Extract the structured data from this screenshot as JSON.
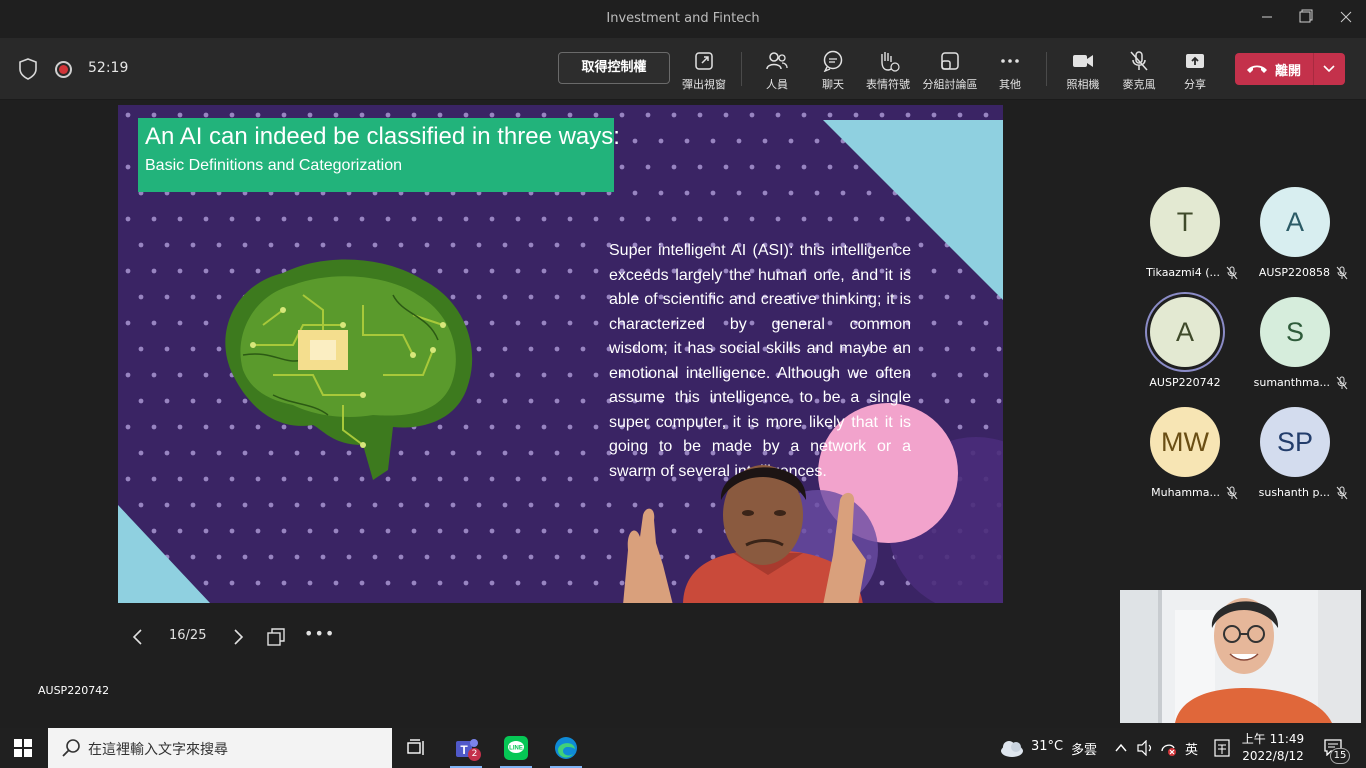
{
  "window": {
    "title": "Investment and Fintech"
  },
  "toolbar": {
    "timer": "52:19",
    "take_control": "取得控制權",
    "popout": "彈出視窗",
    "people": "人員",
    "chat": "聊天",
    "reactions": "表情符號",
    "breakout": "分組討論區",
    "more": "其他",
    "camera": "照相機",
    "mic": "麥克風",
    "share": "分享",
    "leave": "離開"
  },
  "slide": {
    "title": "An AI can indeed be classified in three ways:",
    "subtitle": "Basic Definitions and Categorization",
    "body": "Super intelligent AI (ASI): this intelligence exceeds largely the human one, and it is able of scientific and creative thinking; it is characterized by general common wisdom; it has social skills and maybe an emotional intelligence. Although we often assume this intelligence to be a single super computer, it is more likely that it is going to be made by a network or a swarm of several intelligences.",
    "counter": "16/25",
    "presenter": "AUSP220742"
  },
  "participants": [
    {
      "initials": "T",
      "name": "Tikaazmi4 (...",
      "bg": "#e3e9d2",
      "fg": "#3f4a2a",
      "muted": true
    },
    {
      "initials": "A",
      "name": "AUSP220858",
      "bg": "#d8eef0",
      "fg": "#2b5b66",
      "muted": true
    },
    {
      "initials": "A",
      "name": "AUSP220742",
      "bg": "#e3e9d2",
      "fg": "#3f4a2a",
      "muted": false
    },
    {
      "initials": "S",
      "name": "sumanthma...",
      "bg": "#d6eddc",
      "fg": "#2e5b3a",
      "muted": true
    },
    {
      "initials": "MW",
      "name": "Muhamma...",
      "bg": "#f7e5b4",
      "fg": "#6a4e14",
      "muted": true
    },
    {
      "initials": "SP",
      "name": "sushanth p...",
      "bg": "#d3dcee",
      "fg": "#233d6b",
      "muted": true
    }
  ],
  "taskbar": {
    "search_placeholder": "在這裡輸入文字來搜尋",
    "teams_badge": "2",
    "temperature": "31°C",
    "weather": "多雲",
    "ime": "英",
    "time": "上午 11:49",
    "date": "2022/8/12",
    "notifications": "15"
  },
  "colors": {
    "slide_bg": "#3a2464",
    "slide_header": "#22b37b",
    "leave_button": "#c4314b",
    "triangle": "#8fd0e0",
    "pink_circle": "#f2a3cc"
  }
}
